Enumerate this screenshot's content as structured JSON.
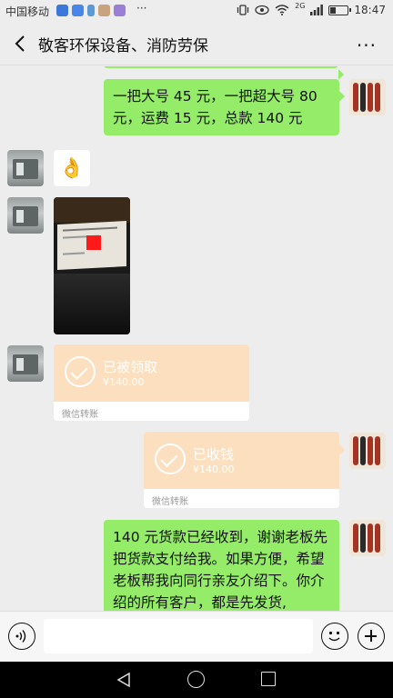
{
  "status_bar": {
    "carrier": "中国移动",
    "dots": "···",
    "network": "2G",
    "time": "18:47"
  },
  "header": {
    "title": "敬客环保设备、消防劳保",
    "back_icon": "chevron-left-icon",
    "more_icon": "more-dots-icon"
  },
  "messages": [
    {
      "side": "right",
      "type": "text",
      "text": "一把大号 45 元，一把超大号 80 元，运费 15 元，总款 140 元"
    },
    {
      "side": "left",
      "type": "emoji",
      "emoji": "👌"
    },
    {
      "side": "left",
      "type": "image",
      "description_icon": "photo-icon"
    },
    {
      "side": "left",
      "type": "transfer",
      "status": "已被领取",
      "amount": "¥140.00",
      "footer": "微信转账"
    },
    {
      "side": "right",
      "type": "transfer",
      "status": "已收钱",
      "amount": "¥140.00",
      "footer": "微信转账"
    },
    {
      "side": "right",
      "type": "text",
      "text": "140 元货款已经收到，谢谢老板先把货款支付给我。如果方便，希望老板帮我向同行亲友介绍下。你介绍的所有客户，都是先发货,"
    }
  ],
  "input_bar": {
    "value": "",
    "placeholder": ""
  },
  "colors": {
    "bubble_green": "#95ec69",
    "transfer_orange": "#fbdfbf",
    "background": "#ededed"
  }
}
